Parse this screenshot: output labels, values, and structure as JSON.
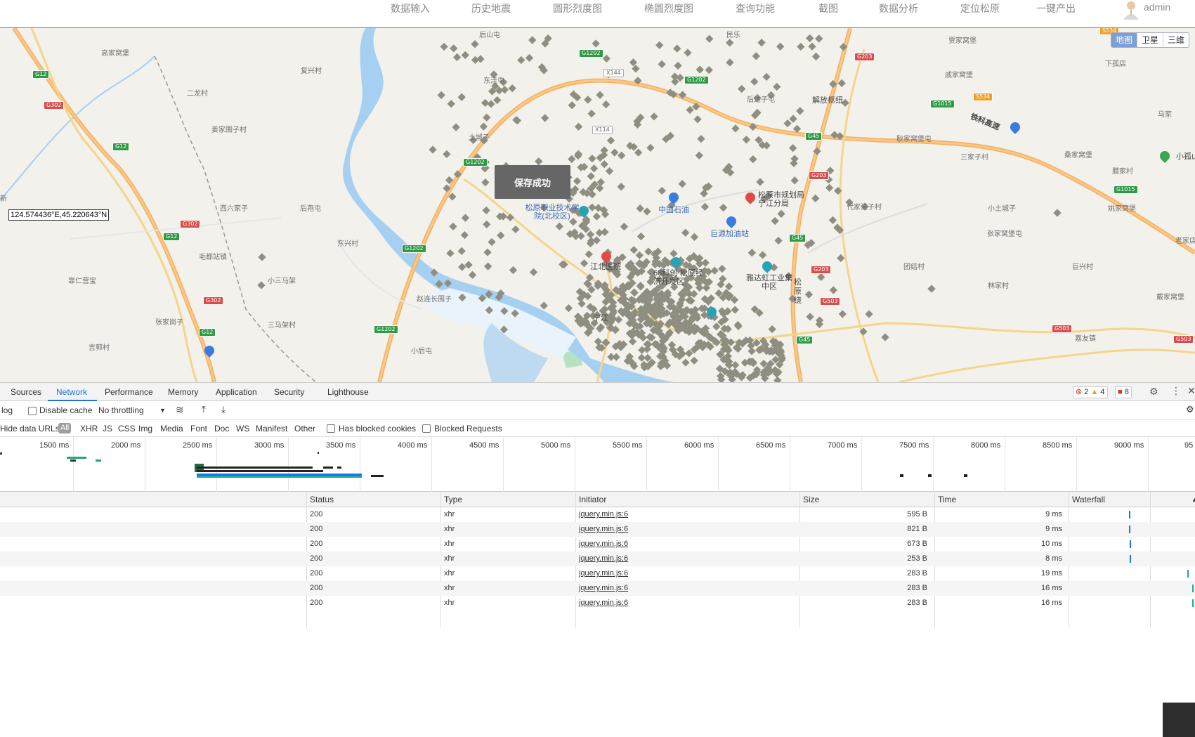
{
  "nav": {
    "items": [
      "数据输入",
      "历史地震",
      "圆形烈度图",
      "椭圆烈度图",
      "查询功能",
      "截图",
      "数据分析",
      "定位松原",
      "一键产出"
    ],
    "user": "admin"
  },
  "map": {
    "type_buttons": [
      "地图",
      "卫星",
      "三维"
    ],
    "coordinate_readout": "124.574436°E,45.220643°N",
    "coord_prefix": "新",
    "toast": "保存成功",
    "places": [
      {
        "text": "高家窝堡"
      },
      {
        "text": "复兴村"
      },
      {
        "text": "后山屯"
      },
      {
        "text": "民乐"
      },
      {
        "text": "二龙村"
      },
      {
        "text": "东洼屯"
      },
      {
        "text": "姜家围子村"
      },
      {
        "text": "土城子"
      },
      {
        "text": "西六家子"
      },
      {
        "text": "后孢屯"
      },
      {
        "text": "毛都站镇"
      },
      {
        "text": "东兴村"
      },
      {
        "text": "靠仁营宝"
      },
      {
        "text": "小三马架"
      },
      {
        "text": "赵连长围子"
      },
      {
        "text": "三马架村"
      },
      {
        "text": "张家岗子"
      },
      {
        "text": "吉郭村"
      },
      {
        "text": "小后屯"
      },
      {
        "text": "后达子屯"
      },
      {
        "text": "贾家窝堡"
      },
      {
        "text": "下孤店"
      },
      {
        "text": "戚家窝堡"
      },
      {
        "text": "耿家窝堡屯"
      },
      {
        "text": "三家子村"
      },
      {
        "text": "桑家窝堡"
      },
      {
        "text": "马家"
      },
      {
        "text": "腊家村"
      },
      {
        "text": "代家洼子村"
      },
      {
        "text": "小土城子"
      },
      {
        "text": "姚家窝堡"
      },
      {
        "text": "张家窝堡屯"
      },
      {
        "text": "老家店"
      },
      {
        "text": "团结村"
      },
      {
        "text": "巨兴村"
      },
      {
        "text": "林家村"
      },
      {
        "text": "戴家窝堡"
      },
      {
        "text": "嘉友镇"
      },
      {
        "text": "小孤山"
      }
    ],
    "major_labels": {
      "jiefang": "解放枢纽",
      "tieke": "铁科高速",
      "songyuan_huan": "松原绕",
      "jiangbei": "江北医院",
      "ningjiang": "宁江"
    },
    "pois": {
      "college": "松原职业技术学院(北校区)",
      "sinopec": "中国石油",
      "julong": "巨源加油站",
      "planning": "松原市规划局宁江分局",
      "yada": "雅达虹工业集中区",
      "gaoxin": "68科创·松原经济开发区"
    },
    "shields": [
      "G12",
      "G302",
      "G12",
      "G302",
      "G12",
      "G302",
      "G12",
      "G1202",
      "G1202",
      "G1202",
      "G1202",
      "G1202",
      "G203",
      "G45",
      "G203",
      "G45",
      "G203",
      "G503",
      "G503",
      "G1015",
      "S534",
      "G1015",
      "G503",
      "G45",
      "X144",
      "X114",
      "S534"
    ]
  },
  "devtools": {
    "tabs": [
      "Sources",
      "Network",
      "Performance",
      "Memory",
      "Application",
      "Security",
      "Lighthouse"
    ],
    "active_tab": "Network",
    "badges": {
      "errors": "2",
      "warnings": "4",
      "issues": "8"
    },
    "toolbar": {
      "preserve_log": "log",
      "disable_cache": "Disable cache",
      "throttling": "No throttling"
    },
    "filter": {
      "hide_data_urls": "Hide data URLs",
      "all": "All",
      "types": [
        "XHR",
        "JS",
        "CSS",
        "Img",
        "Media",
        "Font",
        "Doc",
        "WS",
        "Manifest",
        "Other"
      ],
      "has_blocked_cookies": "Has blocked cookies",
      "blocked_requests": "Blocked Requests"
    },
    "timeline_ticks": [
      "1500 ms",
      "2000 ms",
      "2500 ms",
      "3000 ms",
      "3500 ms",
      "4000 ms",
      "4500 ms",
      "5000 ms",
      "5500 ms",
      "6000 ms",
      "6500 ms",
      "7000 ms",
      "7500 ms",
      "8000 ms",
      "8500 ms",
      "9000 ms",
      "95"
    ],
    "columns": [
      "Status",
      "Type",
      "Initiator",
      "Size",
      "Time",
      "Waterfall"
    ],
    "rows": [
      {
        "status": "200",
        "type": "xhr",
        "initiator": "jquery.min.js:6",
        "size": "595 B",
        "time": "9 ms"
      },
      {
        "status": "200",
        "type": "xhr",
        "initiator": "jquery.min.js:6",
        "size": "821 B",
        "time": "9 ms"
      },
      {
        "status": "200",
        "type": "xhr",
        "initiator": "jquery.min.js:6",
        "size": "673 B",
        "time": "10 ms"
      },
      {
        "status": "200",
        "type": "xhr",
        "initiator": "jquery.min.js:6",
        "size": "253 B",
        "time": "8 ms"
      },
      {
        "status": "200",
        "type": "xhr",
        "initiator": "jquery.min.js:6",
        "size": "283 B",
        "time": "19 ms"
      },
      {
        "status": "200",
        "type": "xhr",
        "initiator": "jquery.min.js:6",
        "size": "283 B",
        "time": "16 ms"
      },
      {
        "status": "200",
        "type": "xhr",
        "initiator": "jquery.min.js:6",
        "size": "283 B",
        "time": "16 ms"
      }
    ]
  }
}
